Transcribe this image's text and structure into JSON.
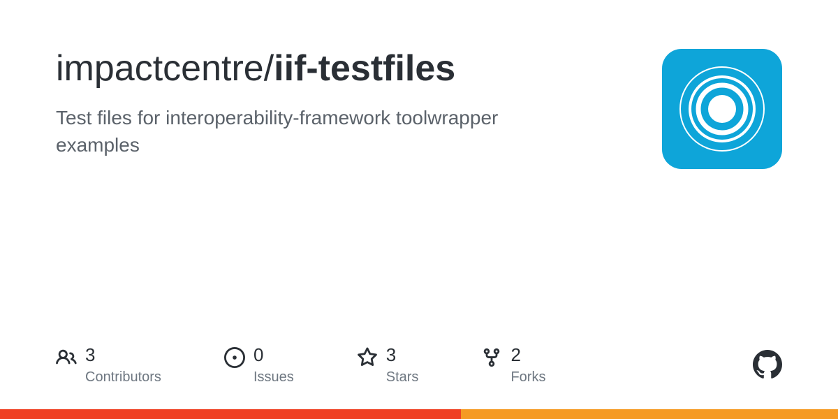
{
  "repo": {
    "owner": "impactcentre",
    "separator": "/",
    "name": "iif-testfiles",
    "description": "Test files for interoperability-framework toolwrapper examples"
  },
  "stats": {
    "contributors": {
      "count": "3",
      "label": "Contributors"
    },
    "issues": {
      "count": "0",
      "label": "Issues"
    },
    "stars": {
      "count": "3",
      "label": "Stars"
    },
    "forks": {
      "count": "2",
      "label": "Forks"
    }
  },
  "colors": {
    "avatar_bg": "#0ea5d9",
    "bar_left": "#ef4023",
    "bar_right": "#f59a23"
  }
}
